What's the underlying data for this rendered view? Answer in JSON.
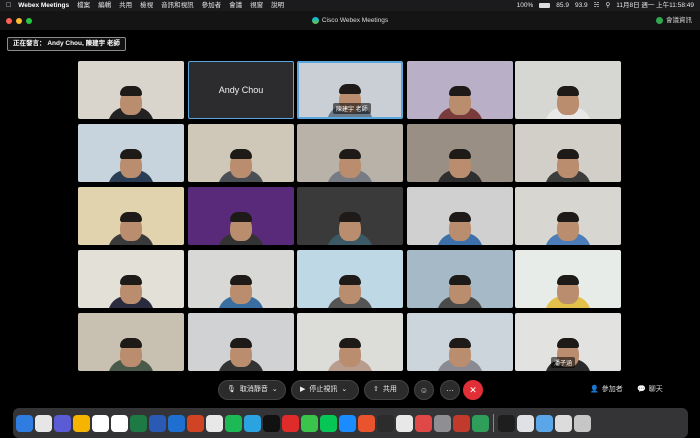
{
  "menubar": {
    "app_name": "Webex Meetings",
    "items": [
      "檔案",
      "編輯",
      "共用",
      "檢視",
      "音訊和視訊",
      "參加者",
      "會議",
      "視窗",
      "說明"
    ],
    "battery": "100%",
    "cpu": "85.9",
    "mem": "93.9",
    "clock": "11月8日 週一 上午11:58:49"
  },
  "window": {
    "title": "Cisco Webex Meetings",
    "meeting_info": "會議資訊"
  },
  "speaking": {
    "label": "正在發言：",
    "names": "Andy Chou,  陳建宇 老師"
  },
  "tiles": [
    {
      "name": "",
      "bg": "#d9d4cc",
      "shirt": "#222"
    },
    {
      "name": "Andy Chou",
      "bg": "#2c2c2e",
      "shirt": "#2c2c2e"
    },
    {
      "name": "陳建宇 老師",
      "bg": "#c9cfd4",
      "shirt": "#6b7b8c"
    },
    {
      "name": "",
      "bg": "#b9b0c8",
      "shirt": "#7a3b3b"
    },
    {
      "name": "",
      "bg": "#d6d6d2",
      "shirt": "#e8e8e8"
    },
    {
      "name": "",
      "bg": "#c7d4dd",
      "shirt": "#2a3d55"
    },
    {
      "name": "",
      "bg": "#cfc7b8",
      "shirt": "#4a4f55"
    },
    {
      "name": "",
      "bg": "#b8b2a8",
      "shirt": "#777c84"
    },
    {
      "name": "",
      "bg": "#9a8f84",
      "shirt": "#2e2e2e"
    },
    {
      "name": "",
      "bg": "#d2cfc9",
      "shirt": "#3c3c3c"
    },
    {
      "name": "",
      "bg": "#e0d3ae",
      "shirt": "#3a3a3a"
    },
    {
      "name": "",
      "bg": "#5a2a7a",
      "shirt": "#333"
    },
    {
      "name": "",
      "bg": "#3a3a3a",
      "shirt": "#3b5a66"
    },
    {
      "name": "",
      "bg": "#cfd0cf",
      "shirt": "#3d6fa8"
    },
    {
      "name": "",
      "bg": "#d8d6d1",
      "shirt": "#4d7db8"
    },
    {
      "name": "",
      "bg": "#e3e0d8",
      "shirt": "#2b2b40"
    },
    {
      "name": "",
      "bg": "#d8d9d6",
      "shirt": "#3a6ea1"
    },
    {
      "name": "",
      "bg": "#bfd8e6",
      "shirt": "#555"
    },
    {
      "name": "",
      "bg": "#a6b9c6",
      "shirt": "#4a4a4a"
    },
    {
      "name": "",
      "bg": "#e8ece8",
      "shirt": "#e3c04a"
    },
    {
      "name": "",
      "bg": "#c8c0b0",
      "shirt": "#4a5a4a"
    },
    {
      "name": "",
      "bg": "#d0d2d4",
      "shirt": "#333"
    },
    {
      "name": "",
      "bg": "#dcdcd8",
      "shirt": "#b89c8e"
    },
    {
      "name": "",
      "bg": "#cdd5dc",
      "shirt": "#8a8a92"
    },
    {
      "name": "潘子涵",
      "bg": "#e2e2e0",
      "shirt": "#2a2a2a"
    }
  ],
  "controls": {
    "mute": "取消靜音",
    "video": "停止視訊",
    "share": "共用",
    "participants": "參加者",
    "chat": "聊天"
  },
  "dock": [
    {
      "icon": "finder-icon",
      "c": "#2f7de1"
    },
    {
      "icon": "safari-icon",
      "c": "#e6e6e6"
    },
    {
      "icon": "launchpad-icon",
      "c": "#5b5bd6"
    },
    {
      "icon": "photos-icon",
      "c": "#f4b400"
    },
    {
      "icon": "calendar-icon",
      "c": "#ffffff"
    },
    {
      "icon": "notes-icon",
      "c": "#ffffff"
    },
    {
      "icon": "excel-icon",
      "c": "#1d7a44"
    },
    {
      "icon": "word-icon",
      "c": "#2b5ab5"
    },
    {
      "icon": "outlook-icon",
      "c": "#1f6fd1"
    },
    {
      "icon": "powerpoint-icon",
      "c": "#d04423"
    },
    {
      "icon": "chrome-icon",
      "c": "#e8e8e8"
    },
    {
      "icon": "spotify-icon",
      "c": "#1db954"
    },
    {
      "icon": "telegram-icon",
      "c": "#2aa3e0"
    },
    {
      "icon": "netflix-icon",
      "c": "#111"
    },
    {
      "icon": "youtube-icon",
      "c": "#e02b2b"
    },
    {
      "icon": "messages-icon",
      "c": "#3bc44b"
    },
    {
      "icon": "line-icon",
      "c": "#06c755"
    },
    {
      "icon": "appstore-icon",
      "c": "#1a8cff"
    },
    {
      "icon": "git-icon",
      "c": "#e9532d"
    },
    {
      "icon": "terminal-icon",
      "c": "#2c2c2c"
    },
    {
      "icon": "fox-icon",
      "c": "#e8e8e8"
    },
    {
      "icon": "arrow-icon",
      "c": "#e04848"
    },
    {
      "icon": "settings-icon",
      "c": "#8e8e93"
    },
    {
      "icon": "media-icon",
      "c": "#c23a2c"
    },
    {
      "icon": "leaf-icon",
      "c": "#2f9e5a"
    },
    {
      "icon": "webex-icon",
      "c": "#1e1e1e"
    },
    {
      "icon": "keyboard-icon",
      "c": "#dfe1e4"
    },
    {
      "icon": "downloads-icon",
      "c": "#5aa6e8"
    },
    {
      "icon": "screenshot-icon",
      "c": "#dcdcdc"
    },
    {
      "icon": "trash-icon",
      "c": "#c6c6c6"
    }
  ]
}
